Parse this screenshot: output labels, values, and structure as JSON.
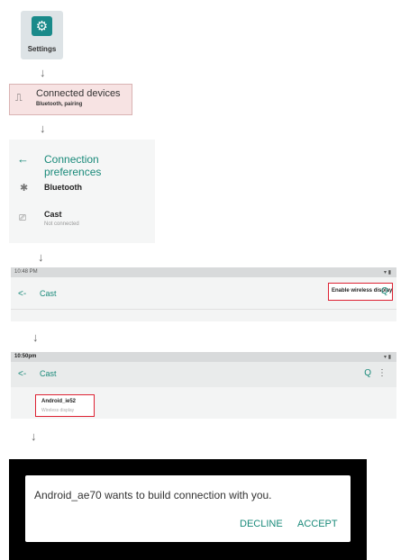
{
  "step1": {
    "icon": "gear-icon",
    "label": "Settings"
  },
  "step2": {
    "icon": "connected-devices-icon",
    "title": "Connected devices",
    "subtitle": "Bluetooth, pairing"
  },
  "step3": {
    "title": "Connection preferences",
    "items": [
      {
        "icon": "bluetooth-icon",
        "label": "Bluetooth"
      },
      {
        "icon": "cast-icon",
        "label": "Cast",
        "subtitle": "Not connected"
      }
    ]
  },
  "step4": {
    "status_time": "10:48 PM",
    "title": "Cast",
    "menu_label": "Enable wireless display"
  },
  "step5": {
    "status_time": "10:50pm",
    "title": "Cast",
    "device_name": "Android_ie52",
    "device_sub": "Wireless display"
  },
  "step6": {
    "message": "Android_ae70 wants to build connection with you.",
    "decline": "DECLINE",
    "accept": "ACCEPT"
  },
  "colors": {
    "accent": "#1a8a7a",
    "highlight_border": "#dd2233",
    "highlight_fill": "#f7e3e3"
  }
}
